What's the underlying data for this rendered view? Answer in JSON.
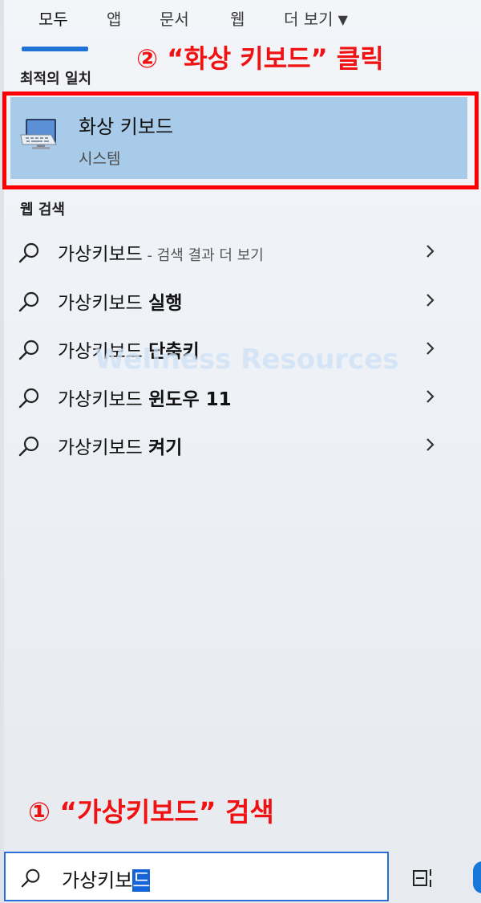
{
  "tabs": {
    "all": "모두",
    "apps": "앱",
    "documents": "문서",
    "web": "웹",
    "more": "더 보기"
  },
  "annotations": {
    "step2": "② “화상 키보드” 클릭",
    "step1": "① “가상키보드” 검색"
  },
  "sections": {
    "best_match": "최적의 일치",
    "web_search": "웹 검색"
  },
  "best_match": {
    "title": "화상 키보드",
    "subtitle": "시스템"
  },
  "web_results": [
    {
      "prefix": "가상키보드",
      "bold": "",
      "suffix": " - 검색 결과 더 보기"
    },
    {
      "prefix": "가상키보드 ",
      "bold": "실행",
      "suffix": ""
    },
    {
      "prefix": "가상키보드 ",
      "bold": "단축키",
      "suffix": ""
    },
    {
      "prefix": "가상키보드 ",
      "bold": "윈도우 11",
      "suffix": ""
    },
    {
      "prefix": "가상키보드 ",
      "bold": "켜기",
      "suffix": ""
    }
  ],
  "watermark": "Wellness Resources",
  "search": {
    "typed": "가상키보",
    "selected": "드"
  },
  "colors": {
    "accent": "#1f72d6",
    "highlight_bg": "#a8cbe9",
    "annotation_red": "#f01212"
  },
  "icons": {
    "tab_more": "caret-down-icon",
    "result": "search-icon",
    "result_arrow": "chevron-right-icon",
    "best_match": "on-screen-keyboard-icon",
    "taskbar": "task-view-icon"
  }
}
